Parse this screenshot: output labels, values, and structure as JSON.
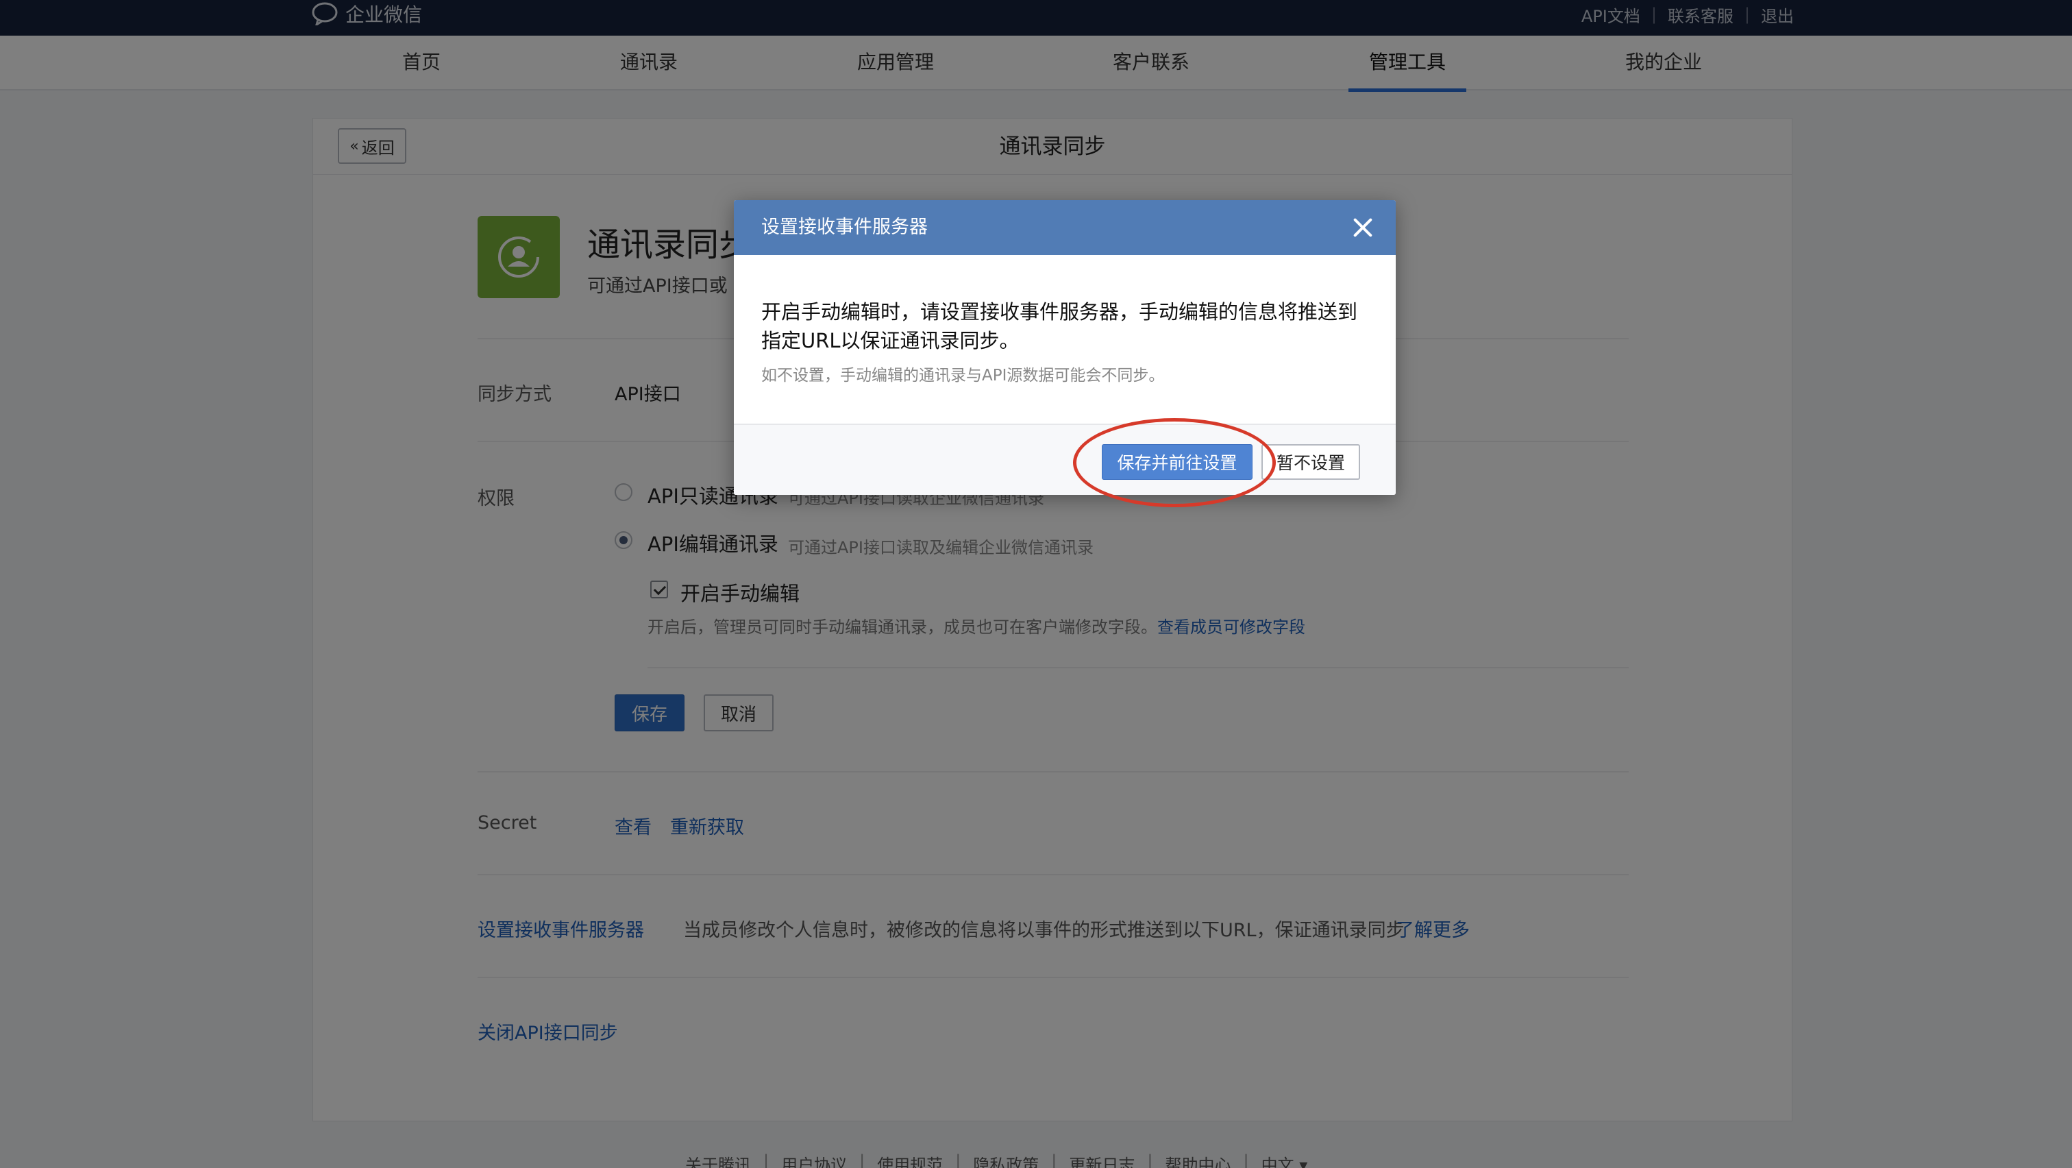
{
  "topbar": {
    "logo_text": "企业微信",
    "links": [
      "API文档",
      "联系客服",
      "退出"
    ]
  },
  "nav": {
    "items": [
      "首页",
      "通讯录",
      "应用管理",
      "客户联系",
      "管理工具",
      "我的企业"
    ],
    "active_index": 4
  },
  "panel": {
    "back_label": "返回",
    "title": "通讯录同步",
    "app_name": "通讯录同步",
    "app_desc": "可通过API接口或",
    "sync_label": "同步方式",
    "sync_value": "API接口",
    "perm_label": "权限",
    "perm_options": [
      {
        "label": "API只读通讯录",
        "desc": "可通过API接口读取企业微信通讯录",
        "selected": false
      },
      {
        "label": "API编辑通讯录",
        "desc": "可通过API接口读取及编辑企业微信通讯录",
        "selected": true
      }
    ],
    "manual_edit_label": "开启手动编辑",
    "manual_edit_desc": "开启后，管理员可同时手动编辑通讯录，成员也可在客户端修改字段。",
    "manual_edit_link": "查看成员可修改字段",
    "save_label": "保存",
    "cancel_label": "取消",
    "secret_label": "Secret",
    "secret_view": "查看",
    "secret_refresh": "重新获取",
    "event_server_link": "设置接收事件服务器",
    "event_server_desc": "当成员修改个人信息时，被修改的信息将以事件的形式推送到以下URL，保证通讯录同步",
    "event_server_more": "了解更多",
    "close_api_link": "关闭API接口同步"
  },
  "footer": {
    "links": [
      "关于腾讯",
      "用户协议",
      "使用规范",
      "隐私政策",
      "更新日志",
      "帮助中心",
      "中文 ▾"
    ]
  },
  "modal": {
    "title": "设置接收事件服务器",
    "text": "开启手动编辑时，请设置接收事件服务器，手动编辑的信息将推送到指定URL以保证通讯录同步。",
    "note": "如不设置，手动编辑的通讯录与API源数据可能会不同步。",
    "primary_label": "保存并前往设置",
    "secondary_label": "暂不设置"
  },
  "colors": {
    "topbar": "#17233c",
    "modal_header": "#517cb5",
    "primary_button": "#4f84d3",
    "link": "#1f5fb8",
    "annotation": "#d63a2a",
    "app_icon": "#7bb33a"
  }
}
